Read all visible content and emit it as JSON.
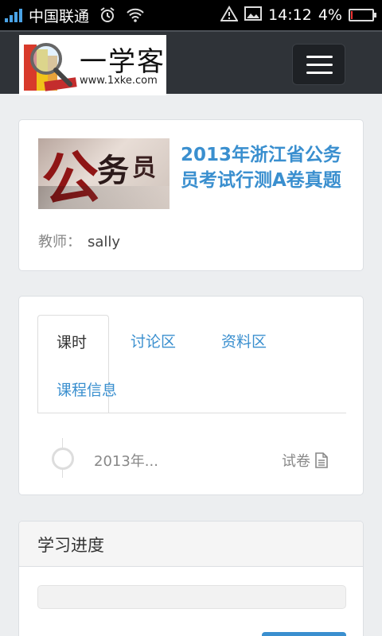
{
  "status_bar": {
    "carrier": "中国联通",
    "time": "14:12",
    "battery": "4%",
    "battery_level": 0.04
  },
  "header": {
    "logo_text": "一学客",
    "logo_url": "www.1xke.com"
  },
  "course": {
    "title": "2013年浙江省公务员考试行测A卷真题",
    "teacher_label": "教师：",
    "teacher_name": "sally"
  },
  "tabs": [
    {
      "label": "课时"
    },
    {
      "label": "讨论区"
    },
    {
      "label": "资料区"
    },
    {
      "label": "课程信息"
    }
  ],
  "lessons": [
    {
      "title": "2013年...",
      "type": "试卷"
    }
  ],
  "progress": {
    "title": "学习进度",
    "value": 0
  },
  "colors": {
    "accent": "#3a8fcf",
    "navbar": "#2f3338"
  }
}
